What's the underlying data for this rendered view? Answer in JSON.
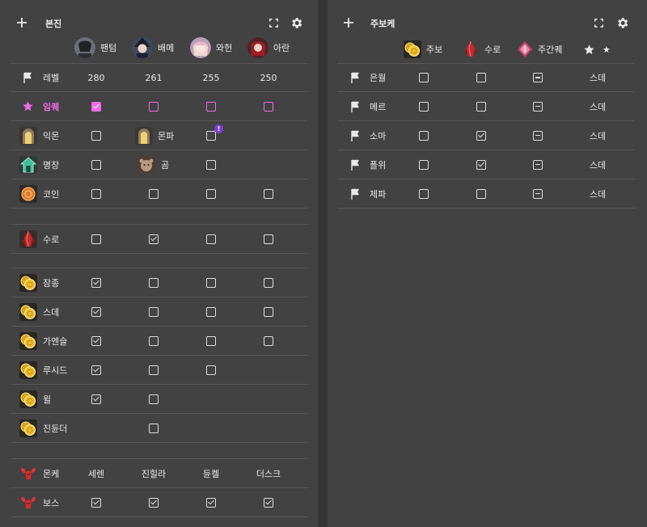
{
  "colors": {
    "background": "#343434",
    "panel": "#424242",
    "accent_pink": "#ef6be8",
    "badge_purple": "#7b3fd8"
  },
  "left": {
    "title": "본진",
    "add_icon": "plus-icon",
    "expand_icon": "expand-icon",
    "settings_icon": "gear-icon",
    "characters": [
      {
        "name": "팬텀",
        "avatar": "avatar-phantom"
      },
      {
        "name": "배메",
        "avatar": "avatar-battle-mage"
      },
      {
        "name": "와헌",
        "avatar": "avatar-wild-hunter"
      },
      {
        "name": "아란",
        "avatar": "avatar-aran"
      }
    ],
    "level_row": {
      "label": "레벨",
      "values": [
        "280",
        "261",
        "255",
        "250"
      ]
    },
    "rows": [
      {
        "label": "임퀘",
        "icon": "star-icon",
        "pink": true,
        "cells": [
          true,
          false,
          false,
          false
        ]
      },
      {
        "label": "익몬",
        "icon": "gate-icon",
        "cells": [
          false
        ],
        "extra": {
          "label": "몬파",
          "icon": "gate-icon"
        },
        "cells2": [
          false
        ],
        "badge": "!"
      },
      {
        "label": "명장",
        "icon": "house-icon",
        "cells": [
          false
        ],
        "extra": {
          "label": "곰",
          "icon": "bear-icon"
        },
        "cells2": [
          false
        ]
      },
      {
        "label": "코인",
        "icon": "coin-icon",
        "cells": [
          false,
          false,
          false,
          false
        ]
      },
      {
        "label": "수로",
        "icon": "crystal-icon",
        "cells": [
          false,
          true,
          false,
          false
        ]
      },
      {
        "label": "잠종",
        "icon": "gold-icon",
        "cells": [
          true,
          false,
          false,
          false
        ]
      },
      {
        "label": "스데",
        "icon": "gold-icon",
        "cells": [
          true,
          false,
          false,
          false
        ]
      },
      {
        "label": "가엔슬",
        "icon": "gold-icon",
        "cells": [
          true,
          false,
          false,
          false
        ]
      },
      {
        "label": "루시드",
        "icon": "gold-icon",
        "cells": [
          true,
          false,
          false
        ]
      },
      {
        "label": "윌",
        "icon": "gold-icon",
        "cells": [
          true,
          false
        ]
      },
      {
        "label": "진듄더",
        "icon": "gold-icon",
        "cells": [
          null,
          false
        ]
      }
    ],
    "boss_header": {
      "label": "몬케",
      "icon": "ram-icon",
      "columns": [
        "세렌",
        "진힐라",
        "듄켈",
        "더스크"
      ]
    },
    "boss_row": {
      "label": "보스",
      "icon": "ram-icon",
      "cells": [
        true,
        true,
        true,
        true
      ]
    }
  },
  "right": {
    "title": "주보케",
    "add_icon": "plus-icon",
    "expand_icon": "expand-icon",
    "settings_icon": "gear-icon",
    "columns": [
      {
        "label": "주보",
        "icon": "gold-icon"
      },
      {
        "label": "수로",
        "icon": "crystal-icon"
      },
      {
        "label": "주간퀘",
        "icon": "pink-gem-icon"
      },
      {
        "label": "★",
        "icon": "star-icon"
      }
    ],
    "rows": [
      {
        "label": "은월",
        "c1": false,
        "c2": false,
        "tag": "스데"
      },
      {
        "label": "메르",
        "c1": false,
        "c2": false,
        "tag": "스데"
      },
      {
        "label": "소마",
        "c1": false,
        "c2": true,
        "tag": "스데"
      },
      {
        "label": "플위",
        "c1": false,
        "c2": true,
        "tag": "스데"
      },
      {
        "label": "제파",
        "c1": false,
        "c2": false,
        "tag": "스데"
      }
    ]
  }
}
